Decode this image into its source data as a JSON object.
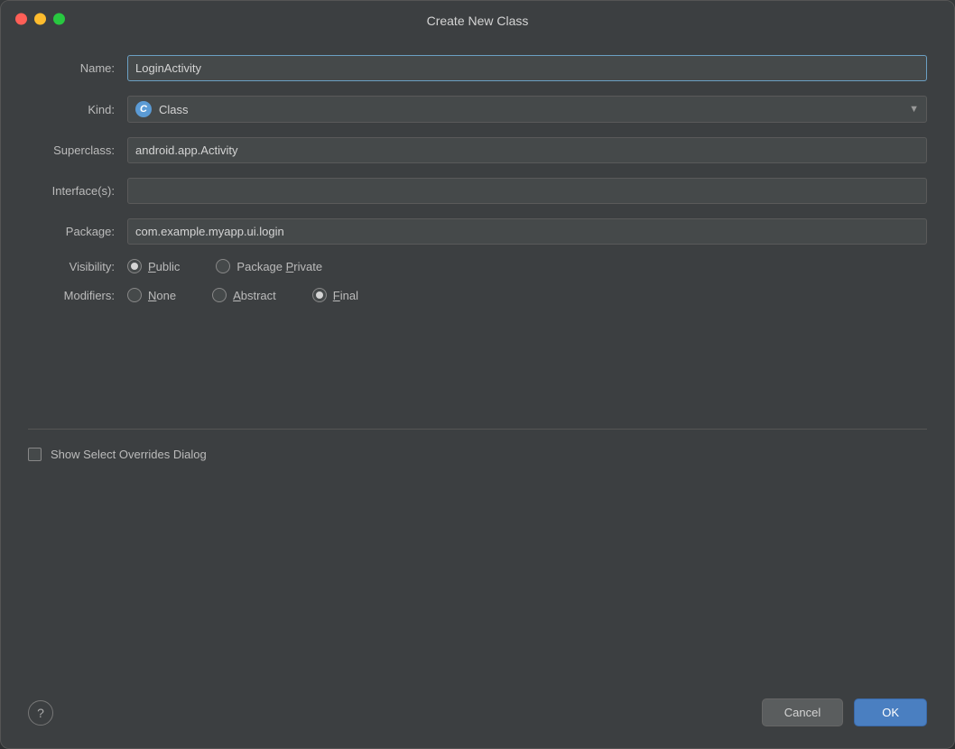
{
  "window": {
    "title": "Create New Class",
    "controls": {
      "close_label": "",
      "minimize_label": "",
      "maximize_label": ""
    }
  },
  "form": {
    "name_label": "Name:",
    "name_value": "LoginActivity",
    "name_placeholder": "",
    "kind_label": "Kind:",
    "kind_value": "Class",
    "kind_icon": "C",
    "superclass_label": "Superclass:",
    "superclass_value": "android.app.Activity",
    "interfaces_label": "Interface(s):",
    "interfaces_value": "",
    "package_label": "Package:",
    "package_value": "com.example.myapp.ui.login",
    "visibility_label": "Visibility:",
    "visibility_options": [
      {
        "id": "public",
        "label": "Public",
        "checked": true,
        "underline_index": 1
      },
      {
        "id": "package_private",
        "label": "Package Private",
        "checked": false,
        "underline_index": 8
      }
    ],
    "modifiers_label": "Modifiers:",
    "modifiers_options": [
      {
        "id": "none",
        "label": "None",
        "checked": false,
        "underline_index": 0
      },
      {
        "id": "abstract",
        "label": "Abstract",
        "checked": false,
        "underline_index": 0
      },
      {
        "id": "final",
        "label": "Final",
        "checked": true,
        "underline_index": 0
      }
    ],
    "show_overrides_label": "Show Select Overrides Dialog",
    "show_overrides_checked": false
  },
  "footer": {
    "help_label": "?",
    "cancel_label": "Cancel",
    "ok_label": "OK"
  }
}
